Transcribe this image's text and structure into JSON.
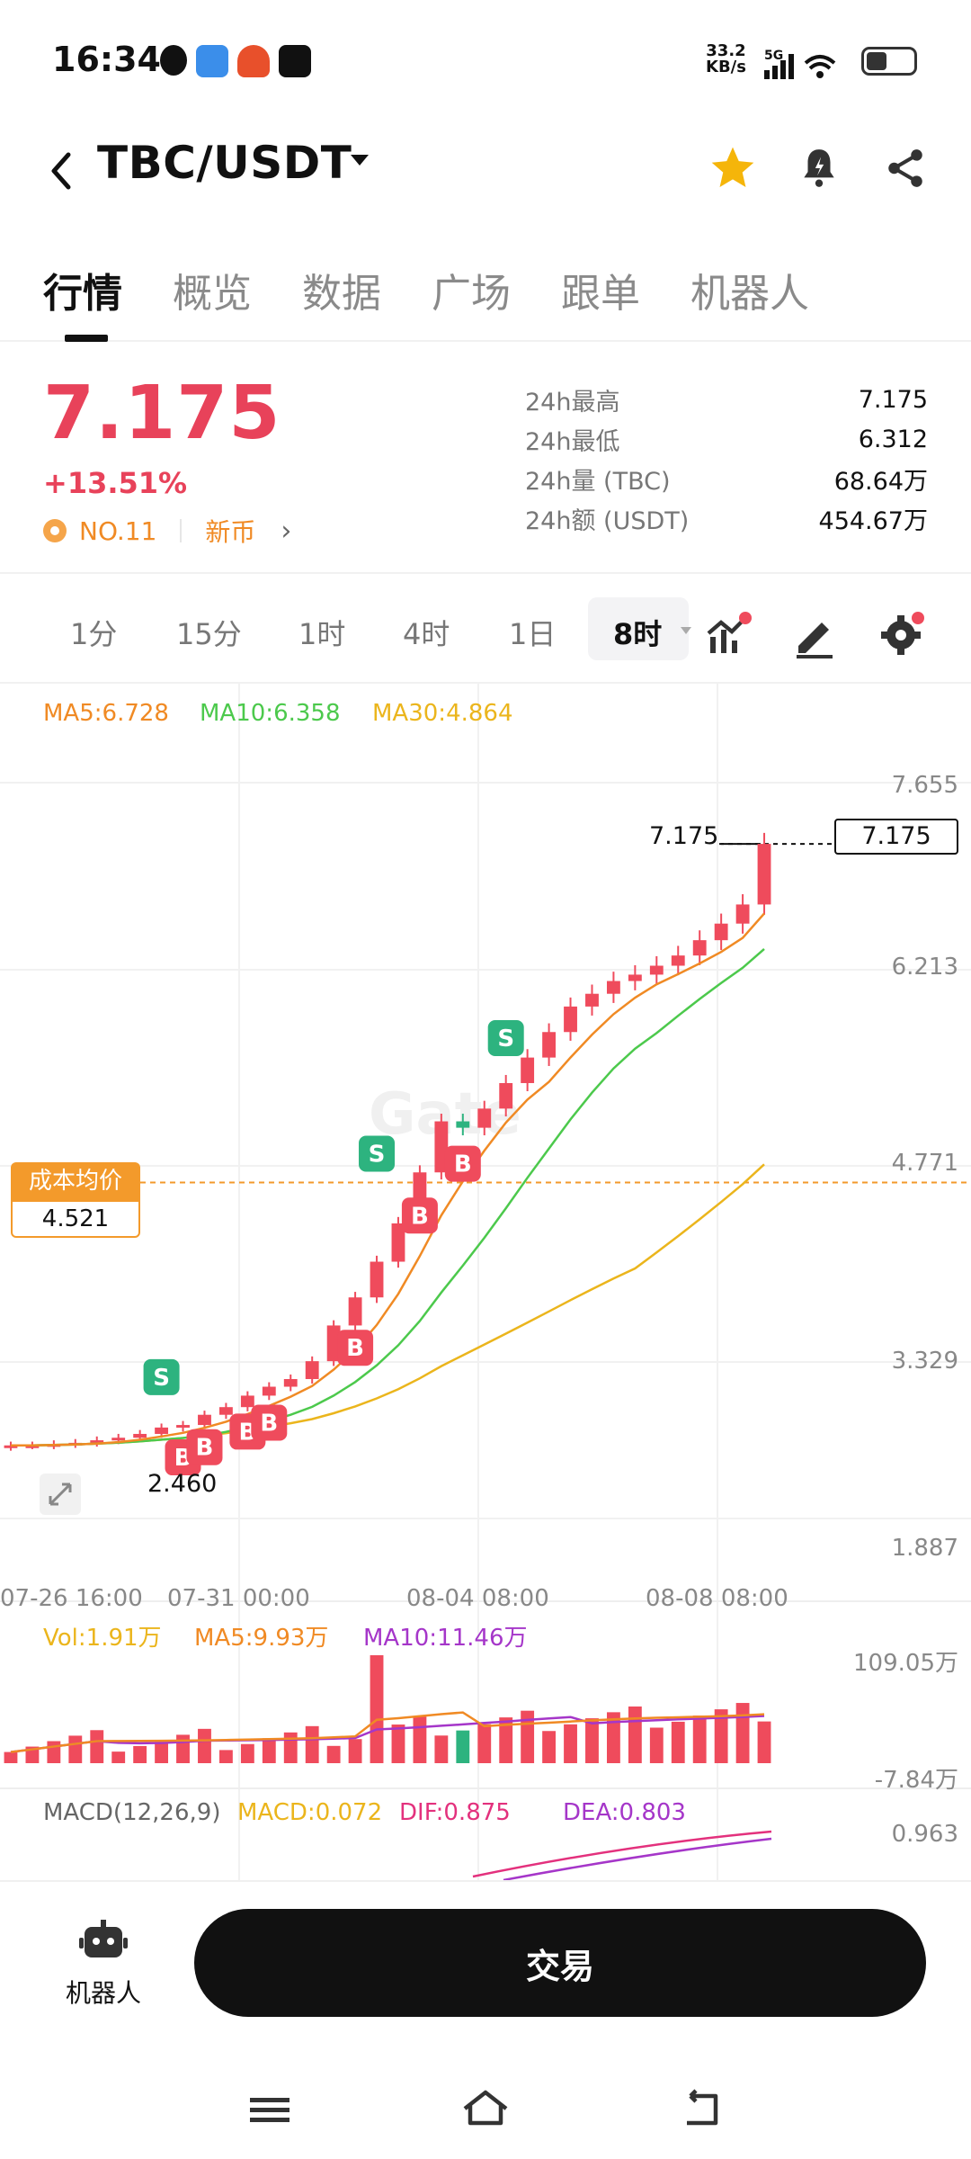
{
  "status": {
    "time": "16:34",
    "speed_value": "33.2",
    "speed_unit": "KB/s",
    "net": "5G"
  },
  "header": {
    "pair": "TBC/USDT"
  },
  "tabs": [
    "行情",
    "概览",
    "数据",
    "广场",
    "跟单",
    "机器人"
  ],
  "price": {
    "last": "7.175",
    "change": "+13.51%",
    "rank": "NO.11",
    "tag": "新币",
    "stats": [
      {
        "k": "24h最高",
        "v": "7.175"
      },
      {
        "k": "24h最低",
        "v": "6.312"
      },
      {
        "k": "24h量 (TBC)",
        "v": "68.64万"
      },
      {
        "k": "24h额 (USDT)",
        "v": "454.67万"
      }
    ]
  },
  "intervals": [
    "1分",
    "15分",
    "1时",
    "4时",
    "1日",
    "8时"
  ],
  "chart": {
    "ma": {
      "ma5": "MA5:6.728",
      "ma10": "MA10:6.358",
      "ma30": "MA30:4.864"
    },
    "yticks": [
      "7.655",
      "6.213",
      "4.771",
      "3.329",
      "1.887"
    ],
    "xticks": [
      "07-26 16:00",
      "07-31 00:00",
      "08-04 08:00",
      "08-08 08:00"
    ],
    "current_price_label": "7.175",
    "current_price_box": "7.175",
    "cost": {
      "title": "成本均价",
      "value": "4.521"
    },
    "low_label": "2.460",
    "markers": {
      "buy": "B",
      "sell": "S"
    },
    "watermark": "Gate",
    "vol": {
      "vol": "Vol:1.91万",
      "ma5": "MA5:9.93万",
      "ma10": "MA10:11.46万",
      "top": "109.05万",
      "bottom": "-7.84万"
    },
    "macd": {
      "title": "MACD(12,26,9)",
      "macd": "MACD:0.072",
      "dif": "DIF:0.875",
      "dea": "DEA:0.803",
      "top": "0.963"
    },
    "colors": {
      "up": "#ef4b5c",
      "down": "#2db37f",
      "ma5": "#f08a24",
      "ma10": "#4cc94c",
      "ma30": "#ebb51c",
      "ma10vol": "#a536c9"
    }
  },
  "chart_data": {
    "type": "candlestick",
    "x_range": [
      "07-26 16:00",
      "08-09 08:00"
    ],
    "ylim": [
      1.887,
      7.655
    ],
    "last_price": 7.175,
    "cost_average": 4.521,
    "closes": [
      2.46,
      2.46,
      2.47,
      2.48,
      2.5,
      2.52,
      2.55,
      2.6,
      2.62,
      2.7,
      2.76,
      2.85,
      2.92,
      2.98,
      3.12,
      3.4,
      3.62,
      3.9,
      4.2,
      4.6,
      5.0,
      4.95,
      5.1,
      5.3,
      5.5,
      5.7,
      5.9,
      6.0,
      6.1,
      6.15,
      6.22,
      6.3,
      6.42,
      6.55,
      6.7,
      7.175
    ]
  },
  "actions": {
    "robot": "机器人",
    "trade": "交易"
  }
}
